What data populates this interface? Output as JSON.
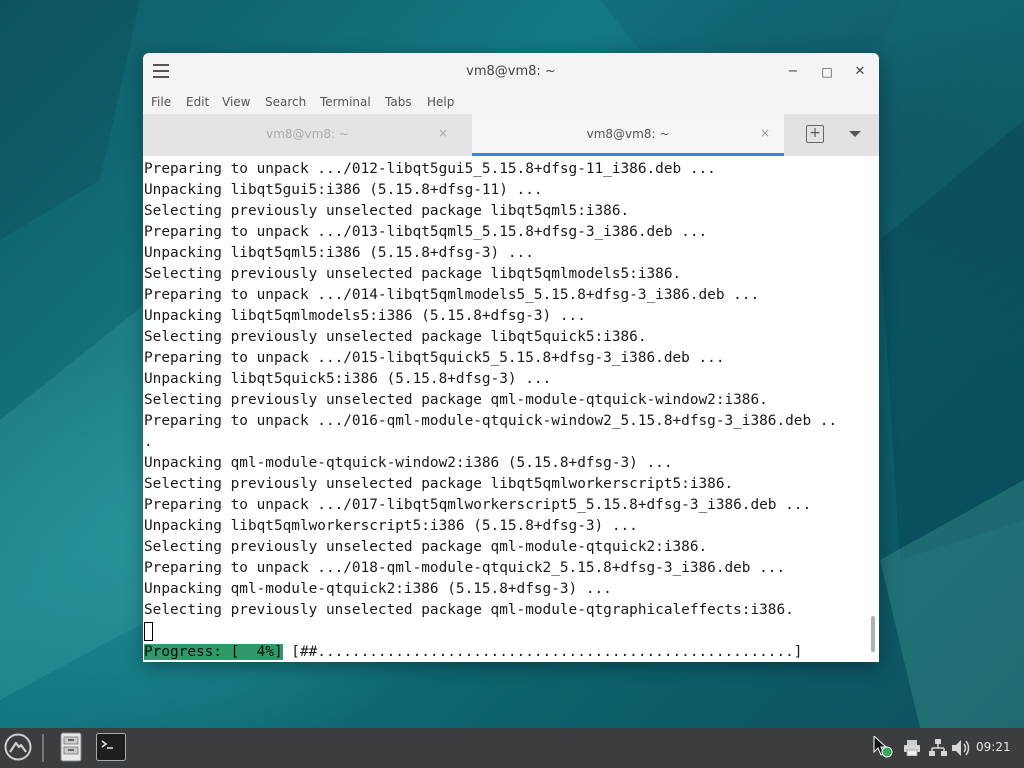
{
  "window": {
    "title": "vm8@vm8: ~",
    "controls": {
      "minimize": "−",
      "maximize": "□",
      "close": "✕"
    }
  },
  "menubar": [
    "File",
    "Edit",
    "View",
    "Search",
    "Terminal",
    "Tabs",
    "Help"
  ],
  "tabs": [
    {
      "label": "vm8@vm8: ~",
      "close": "×",
      "active": false
    },
    {
      "label": "vm8@vm8: ~",
      "close": "×",
      "active": true
    }
  ],
  "new_tab_symbol": "+",
  "terminal": {
    "lines": [
      "Preparing to unpack .../012-libqt5gui5_5.15.8+dfsg-11_i386.deb ...",
      "Unpacking libqt5gui5:i386 (5.15.8+dfsg-11) ...",
      "Selecting previously unselected package libqt5qml5:i386.",
      "Preparing to unpack .../013-libqt5qml5_5.15.8+dfsg-3_i386.deb ...",
      "Unpacking libqt5qml5:i386 (5.15.8+dfsg-3) ...",
      "Selecting previously unselected package libqt5qmlmodels5:i386.",
      "Preparing to unpack .../014-libqt5qmlmodels5_5.15.8+dfsg-3_i386.deb ...",
      "Unpacking libqt5qmlmodels5:i386 (5.15.8+dfsg-3) ...",
      "Selecting previously unselected package libqt5quick5:i386.",
      "Preparing to unpack .../015-libqt5quick5_5.15.8+dfsg-3_i386.deb ...",
      "Unpacking libqt5quick5:i386 (5.15.8+dfsg-3) ...",
      "Selecting previously unselected package qml-module-qtquick-window2:i386.",
      "Preparing to unpack .../016-qml-module-qtquick-window2_5.15.8+dfsg-3_i386.deb ..",
      ".",
      "Unpacking qml-module-qtquick-window2:i386 (5.15.8+dfsg-3) ...",
      "Selecting previously unselected package libqt5qmlworkerscript5:i386.",
      "Preparing to unpack .../017-libqt5qmlworkerscript5_5.15.8+dfsg-3_i386.deb ...",
      "Unpacking libqt5qmlworkerscript5:i386 (5.15.8+dfsg-3) ...",
      "Selecting previously unselected package qml-module-qtquick2:i386.",
      "Preparing to unpack .../018-qml-module-qtquick2_5.15.8+dfsg-3_i386.deb ...",
      "Unpacking qml-module-qtquick2:i386 (5.15.8+dfsg-3) ...",
      "Selecting previously unselected package qml-module-qtgraphicaleffects:i386."
    ],
    "progress_label": "Progress: [  4%]",
    "progress_bar": " [##.......................................................]",
    "progress_percent": 4
  },
  "taskbar": {
    "clock": "09:21",
    "icons": [
      "start-menu-icon",
      "file-manager-icon",
      "terminal-icon"
    ],
    "tray_icons": [
      "update-notifier-icon",
      "printer-icon",
      "network-icon",
      "volume-icon"
    ]
  },
  "colors": {
    "progress_highlight": "#2e9a6a",
    "active_tab_underline": "#3a86d4",
    "taskbar": "#3b3d3e",
    "desktop": "#137a84"
  }
}
